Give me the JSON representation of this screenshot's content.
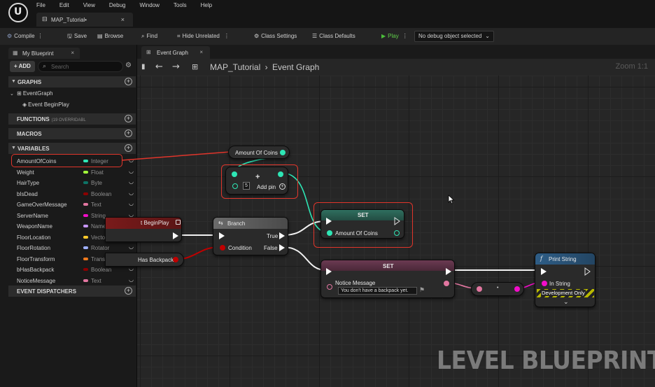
{
  "menu": [
    "File",
    "Edit",
    "View",
    "Debug",
    "Window",
    "Tools",
    "Help"
  ],
  "document_tab": {
    "label": "MAP_Tutorial•"
  },
  "toolbar": {
    "compile": "Compile",
    "save": "Save",
    "browse": "Browse",
    "find": "Find",
    "hide_unrelated": "Hide Unrelated",
    "class_settings": "Class Settings",
    "class_defaults": "Class Defaults",
    "play": "Play",
    "debug_object": "No debug object selected"
  },
  "my_blueprint": {
    "tab_label": "My Blueprint",
    "add_label": "ADD",
    "search_placeholder": "Search",
    "sections": {
      "graphs": "GRAPHS",
      "functions": "FUNCTIONS",
      "functions_note": "(19 OVERRIDABL",
      "macros": "MACROS",
      "variables": "VARIABLES",
      "dispatchers": "EVENT DISPATCHERS"
    },
    "graph_items": [
      "EventGraph",
      "Event BeginPlay"
    ],
    "variables": [
      {
        "name": "AmountOfCoins",
        "type": "Integer",
        "color": "#2ee6b5"
      },
      {
        "name": "Weight",
        "type": "Float",
        "color": "#a3ff3a"
      },
      {
        "name": "HairType",
        "type": "Byte",
        "color": "#0d7366"
      },
      {
        "name": "bIsDead",
        "type": "Boolean",
        "color": "#8c0000"
      },
      {
        "name": "GameOverMessage",
        "type": "Text",
        "color": "#e276a0"
      },
      {
        "name": "ServerName",
        "type": "String",
        "color": "#f20dc9"
      },
      {
        "name": "WeaponName",
        "type": "Name",
        "color": "#c796f7"
      },
      {
        "name": "FloorLocation",
        "type": "Vector",
        "color": "#ffca2b"
      },
      {
        "name": "FloorRotation",
        "type": "Rotator",
        "color": "#9fb0ff"
      },
      {
        "name": "FloorTransform",
        "type": "Transform",
        "color": "#f07a1e"
      },
      {
        "name": "bHasBackpack",
        "type": "Boolean",
        "color": "#8c0000"
      },
      {
        "name": "NoticeMessage",
        "type": "Text",
        "color": "#e276a0"
      }
    ]
  },
  "graph": {
    "tab_label": "Event Graph",
    "breadcrumb_map": "MAP_Tutorial",
    "breadcrumb_sep": "›",
    "breadcrumb_graph": "Event Graph",
    "zoom": "Zoom 1:1",
    "nodes": {
      "amount_getter": "Amount Of Coins",
      "add_value": "5",
      "add_pin": "Add pin",
      "begin_play": "t BeginPlay",
      "branch": "Branch",
      "branch_condition": "Condition",
      "branch_true": "True",
      "branch_false": "False",
      "has_backpack": "Has Backpack",
      "set_coins_title": "SET",
      "set_coins_pin": "Amount Of Coins",
      "set_msg_title": "SET",
      "set_msg_pin": "Notice Message",
      "set_msg_value": "You don't have a backpack yet.",
      "print_title": "Print String",
      "print_in_string": "In String",
      "print_dev_only": "Development Only"
    }
  },
  "watermark": "LEVEL BLUEPRINT",
  "colors": {
    "integer_pin": "#2ee6b5",
    "text_pin": "#e276a0",
    "bool_pin": "#c00000",
    "string_pin": "#f20dc9",
    "highlight": "#e0352b"
  }
}
